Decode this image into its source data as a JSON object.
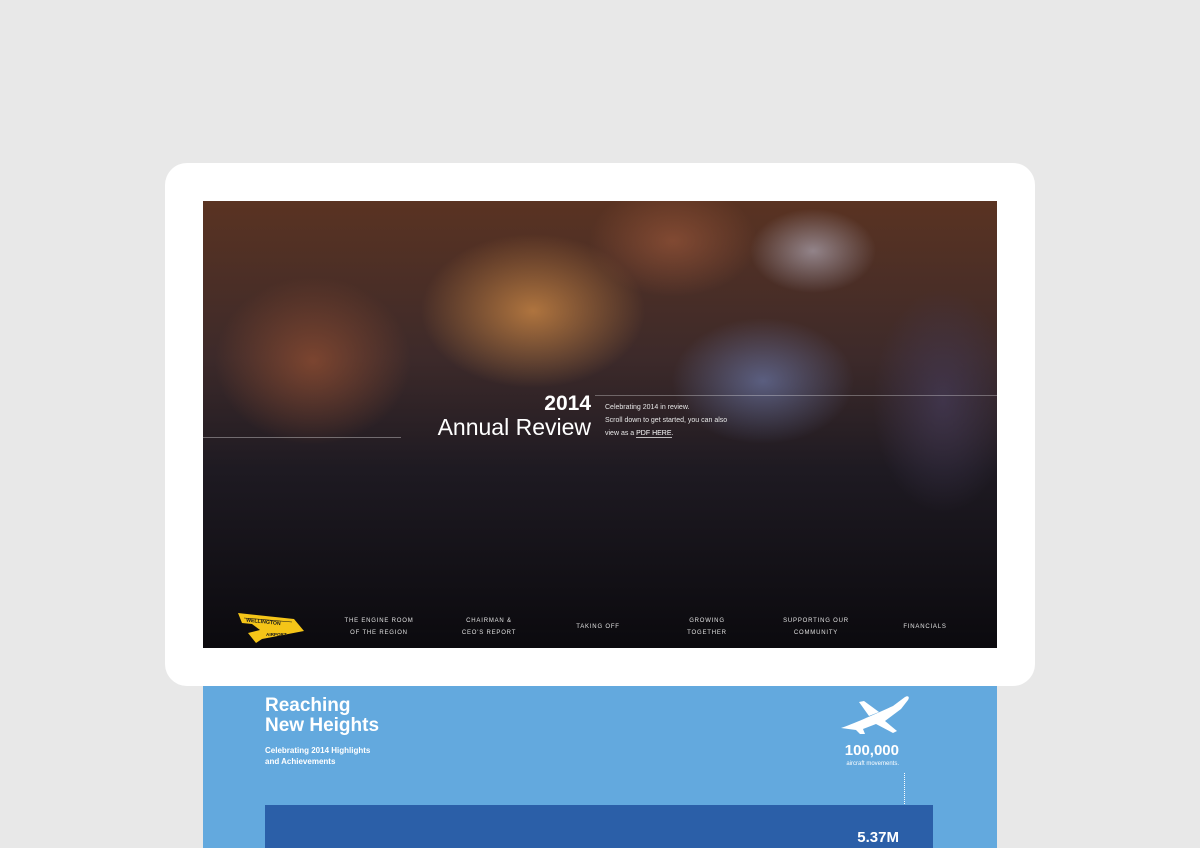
{
  "hero": {
    "year": "2014",
    "title": "Annual Review",
    "intro_line1": "Celebrating 2014 in review.",
    "intro_line2": "Scroll down to get started, you can also",
    "intro_line3_prefix": "view as a ",
    "pdf_link": "PDF HERE",
    "intro_line3_suffix": "."
  },
  "logo": {
    "text": "WELLINGTON",
    "subtext": "AIRPORT",
    "color": "#f5c518"
  },
  "nav": {
    "items": [
      {
        "line1": "THE ENGINE ROOM",
        "line2": "OF THE REGION"
      },
      {
        "line1": "CHAIRMAN &",
        "line2": "CEO'S REPORT"
      },
      {
        "line1": "TAKING OFF",
        "line2": ""
      },
      {
        "line1": "GROWING",
        "line2": "TOGETHER"
      },
      {
        "line1": "SUPPORTING OUR",
        "line2": "COMMUNITY"
      },
      {
        "line1": "FINANCIALS",
        "line2": ""
      }
    ]
  },
  "highlights": {
    "title_line1": "Reaching",
    "title_line2": "New Heights",
    "subtitle_line1": "Celebrating 2014 Highlights",
    "subtitle_line2": "and Achievements",
    "icon": "airplane-icon",
    "stat1_value": "100,000",
    "stat1_label": "aircraft movements.",
    "stat2_value": "5.37M"
  },
  "colors": {
    "page_bg": "#e8e8e8",
    "section_blue": "#63a9de",
    "band_blue": "#2b5fa8",
    "accent_yellow": "#f5c518"
  }
}
